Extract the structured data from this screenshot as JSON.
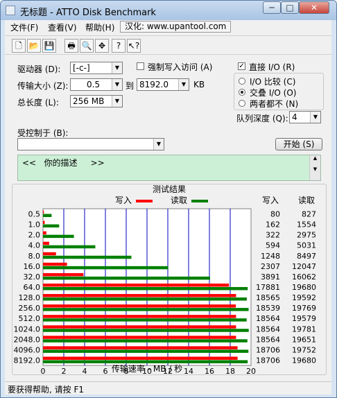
{
  "window": {
    "title": "无标题 - ATTO Disk Benchmark",
    "minimize_glyph": "─",
    "maximize_glyph": "□",
    "close_glyph": "✕"
  },
  "menu": {
    "file": "文件(F)",
    "view": "查看(V)",
    "help": "帮助(H)",
    "localized_by": "汉化: www.upantool.com"
  },
  "toolbar": {
    "buttons": [
      "new-file-icon",
      "open-folder-icon",
      "save-icon",
      "print-icon",
      "print-preview-icon",
      "move-icon",
      "help-icon",
      "context-help-icon"
    ],
    "glyphs": [
      "🗋",
      "📂",
      "💾",
      "🖶",
      "🔍",
      "✥",
      "?",
      "↖?"
    ]
  },
  "settings": {
    "drive_label": "驱动器 (D):",
    "drive_value": "[-c-]",
    "transfer_label": "传输大小 (Z):",
    "transfer_from": "0.5",
    "to_label": "到",
    "transfer_to": "8192.0",
    "kb_unit": "KB",
    "total_length_label": "总长度 (L):",
    "total_length_value": "256 MB",
    "force_write_label": "强制写入访问 (A)",
    "force_write_checked": false,
    "direct_io_label": "直接 I/O (R)",
    "direct_io_checked": true,
    "io_compare_label": "I/O 比较 (C)",
    "overlapped_io_label": "交叠 I/O (O)",
    "neither_label": "两者都不 (N)",
    "selected_io": "overlapped",
    "queue_depth_label": "队列深度 (Q):",
    "queue_depth_value": "4",
    "controlled_by_label": "受控制于 (B):",
    "controlled_by_value": "",
    "start_button": "开始 (S)",
    "description": "<<   你的描述     >>"
  },
  "chart_data": {
    "type": "bar",
    "orientation": "horizontal",
    "title": "测试结果",
    "legend": [
      {
        "name": "写入",
        "color": "#ff0000"
      },
      {
        "name": "读取",
        "color": "#008000"
      }
    ],
    "col_headers": {
      "write": "写入",
      "read": "读取"
    },
    "categories": [
      "0.5",
      "1.0",
      "2.0",
      "4.0",
      "8.0",
      "16.0",
      "32.0",
      "64.0",
      "128.0",
      "256.0",
      "512.0",
      "1024.0",
      "2048.0",
      "4096.0",
      "8192.0"
    ],
    "series": [
      {
        "name": "写入",
        "values": [
          80,
          162,
          322,
          594,
          1248,
          2307,
          3891,
          17881,
          18565,
          18539,
          18564,
          18564,
          18564,
          18706,
          18706
        ]
      },
      {
        "name": "读取",
        "values": [
          827,
          1554,
          2975,
          5031,
          8497,
          12047,
          16062,
          19680,
          19592,
          19769,
          19579,
          19781,
          19651,
          19752,
          19680
        ]
      }
    ],
    "value_scale": 1000,
    "xlabel": "传输速率 - MB / 秒",
    "xlim": [
      0,
      20
    ],
    "xticks": [
      "0",
      "2",
      "4",
      "6",
      "8",
      "10",
      "12",
      "14",
      "16",
      "18",
      "20"
    ],
    "grid": true,
    "colors": {
      "write": "#ff0000",
      "read": "#008000",
      "grid": "#0000c0"
    }
  },
  "status": {
    "text": "要获得帮助, 请按 F1"
  }
}
